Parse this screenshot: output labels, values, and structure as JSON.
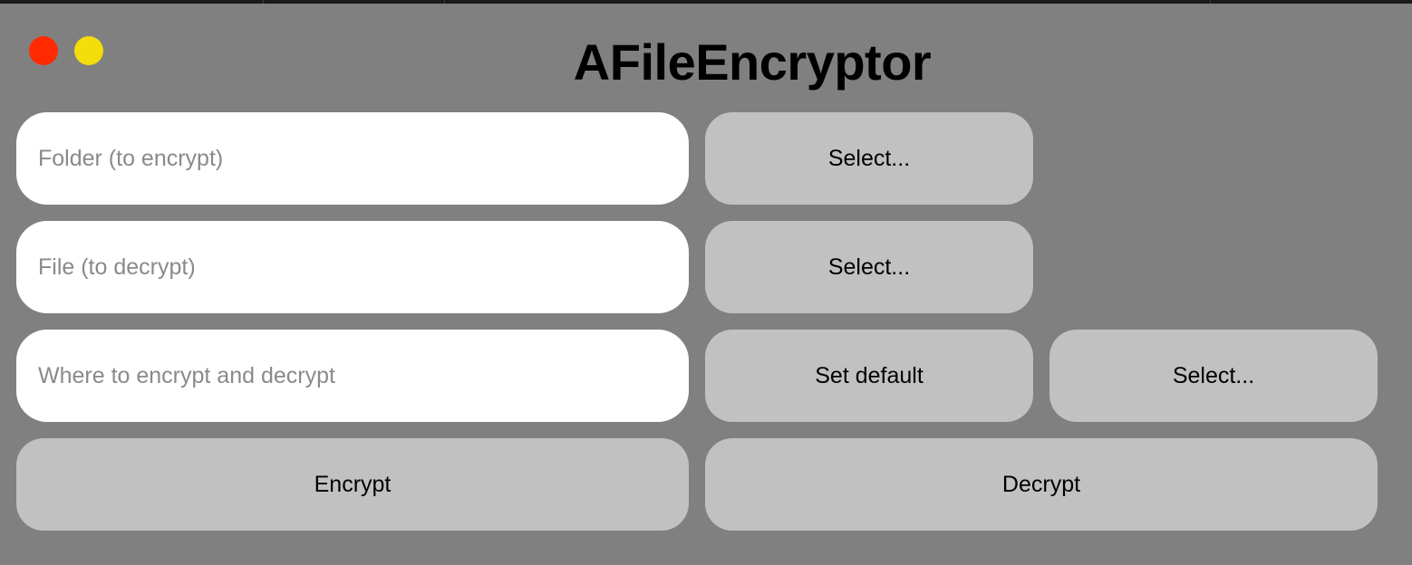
{
  "app": {
    "title": "AFileEncryptor"
  },
  "window_controls": {
    "close_color": "#ff2a00",
    "minimize_color": "#f5dd0c"
  },
  "rows": {
    "folder": {
      "placeholder": "Folder (to encrypt)",
      "value": "",
      "select_label": "Select..."
    },
    "file": {
      "placeholder": "File (to decrypt)",
      "value": "",
      "select_label": "Select..."
    },
    "output": {
      "placeholder": "Where to encrypt and decrypt",
      "value": "",
      "set_default_label": "Set default",
      "select_label": "Select..."
    }
  },
  "actions": {
    "encrypt_label": "Encrypt",
    "decrypt_label": "Decrypt"
  },
  "colors": {
    "background": "#808080",
    "button": "#c1c1c1",
    "field": "#ffffff",
    "placeholder_text": "#8a8a8a"
  }
}
